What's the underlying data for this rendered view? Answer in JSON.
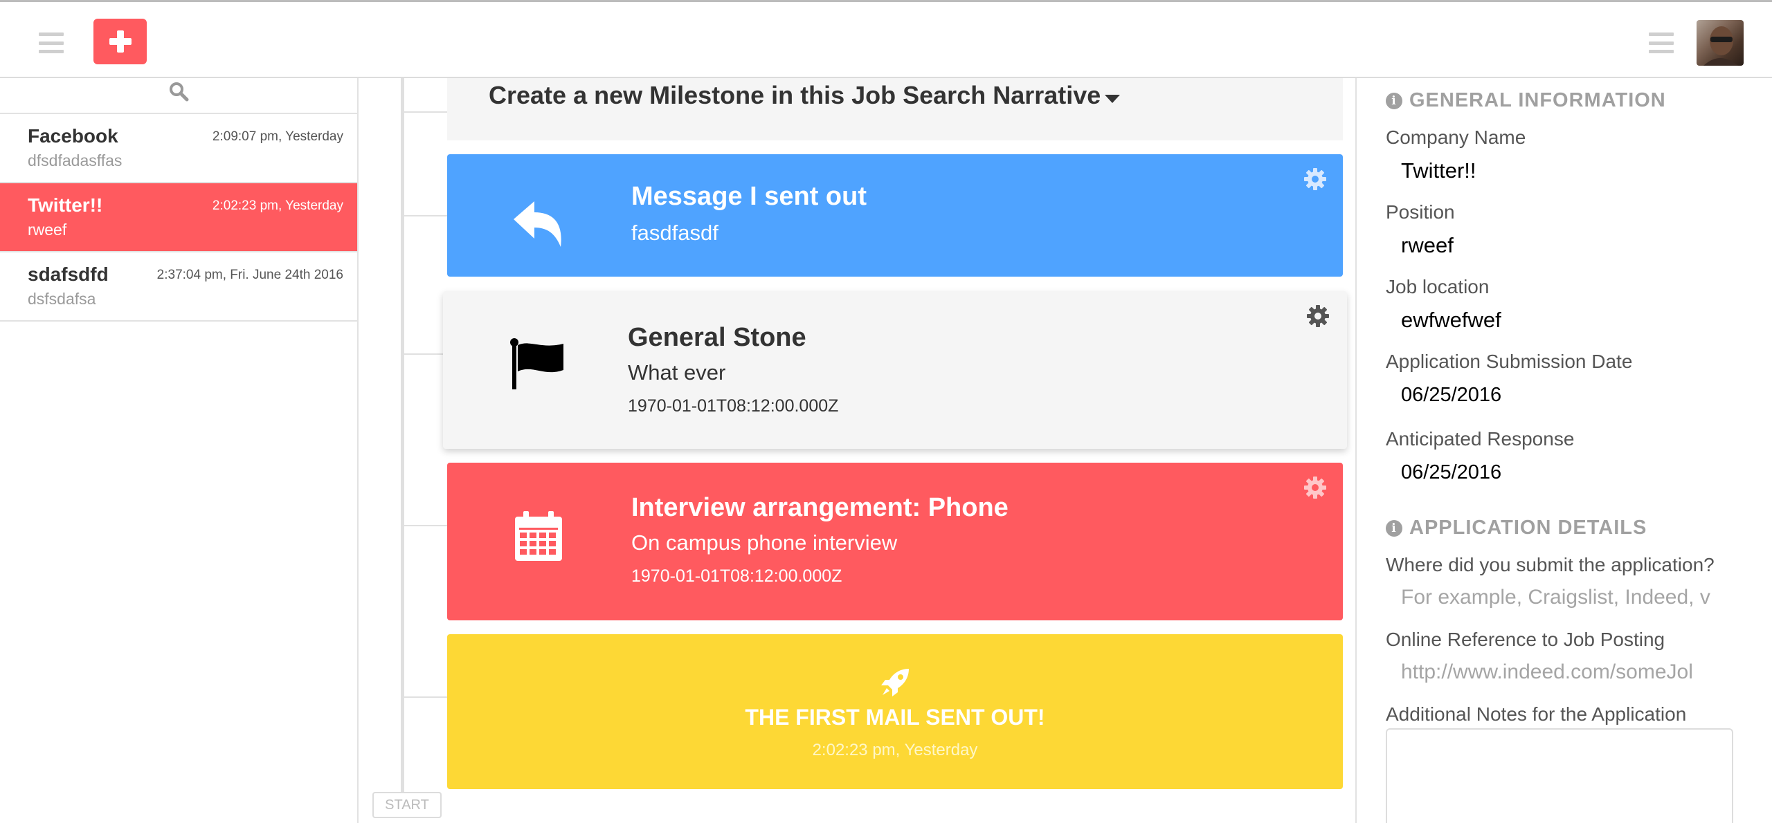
{
  "conversations": [
    {
      "name": "Facebook",
      "subtitle": "dfsdfadasffas",
      "time": "2:09:07 pm, Yesterday"
    },
    {
      "name": "Twitter!!",
      "subtitle": "rweef",
      "time": "2:02:23 pm, Yesterday"
    },
    {
      "name": "sdafsdfd",
      "subtitle": "dsfsdafsa",
      "time": "2:37:04 pm, Fri. June 24th 2016"
    }
  ],
  "timeline": {
    "create_label": "Create a new Milestone in this Job Search Narrative",
    "start_label": "START",
    "cards": [
      {
        "title": "Message I sent out",
        "subtitle": "fasdfasdf",
        "color": "#4fa3ff",
        "icon": "reply-icon"
      },
      {
        "title": "General Stone",
        "subtitle": "What ever",
        "date": "1970-01-01T08:12:00.000Z",
        "color": "#f5f5f5",
        "icon": "flag-icon"
      },
      {
        "title": "Interview arrangement: Phone",
        "subtitle": "On campus phone interview",
        "date": "1970-01-01T08:12:00.000Z",
        "color": "#ff5a5f",
        "icon": "calendar-icon"
      },
      {
        "title": "THE FIRST MAIL SENT OUT!",
        "date": "2:02:23 pm, Yesterday",
        "color": "#fdd835",
        "icon": "rocket-icon"
      }
    ]
  },
  "details": {
    "general_heading": "GENERAL INFORMATION",
    "company_label": "Company Name",
    "company_value": "Twitter!!",
    "position_label": "Position",
    "position_value": "rweef",
    "location_label": "Job location",
    "location_value": "ewfwefwef",
    "submission_label": "Application Submission Date",
    "submission_value": "06/25/2016",
    "response_label": "Anticipated Response",
    "response_value": "06/25/2016",
    "application_heading": "APPLICATION DETAILS",
    "where_label": "Where did you submit the application?",
    "where_placeholder": "For example, Craigslist, Indeed, v",
    "reference_label": "Online Reference to Job Posting",
    "reference_placeholder": "http://www.indeed.com/someJol",
    "notes_label": "Additional Notes for the Application"
  },
  "colors": {
    "accent": "#ff5a5f",
    "blue": "#4fa3ff",
    "yellow": "#fdd835"
  }
}
